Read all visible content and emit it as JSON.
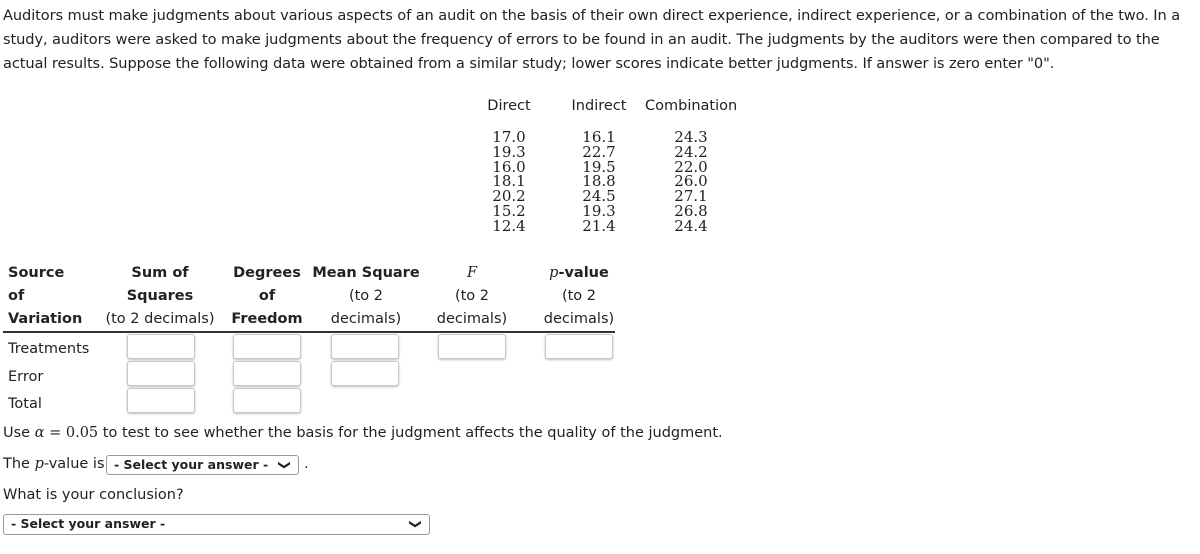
{
  "intro": "Auditors must make judgments about various aspects of an audit on the basis of their own direct experience, indirect experience, or a combination of the two. In a study, auditors were asked to make judgments about the frequency of errors to be found in an audit. The judgments by the auditors were then compared to the actual results. Suppose the following data were obtained from a similar study; lower scores indicate better judgments. If answer is zero enter \"0\".",
  "data_table": {
    "columns": [
      {
        "header": "Direct",
        "values": [
          "17.0",
          "19.3",
          "16.0",
          "18.1",
          "20.2",
          "15.2",
          "12.4"
        ]
      },
      {
        "header": "Indirect",
        "values": [
          "16.1",
          "22.7",
          "19.5",
          "18.8",
          "24.5",
          "19.3",
          "21.4"
        ]
      },
      {
        "header": "Combination",
        "values": [
          "24.3",
          "24.2",
          "22.0",
          "26.0",
          "27.1",
          "26.8",
          "24.4"
        ]
      }
    ]
  },
  "anova": {
    "headers": {
      "source": [
        "Source",
        "of",
        "Variation"
      ],
      "ss": [
        "Sum of",
        "Squares",
        "(to 2 decimals)"
      ],
      "df": [
        "Degrees",
        "of",
        "Freedom"
      ],
      "ms": [
        "Mean Square",
        "(to 2",
        "decimals)"
      ],
      "f": [
        "F",
        "(to 2",
        "decimals)"
      ],
      "p": [
        "p",
        "-value",
        "(to 2",
        "decimals)"
      ]
    },
    "rows": [
      "Treatments",
      "Error",
      "Total"
    ],
    "inputs": {
      "treatments_ss": "",
      "treatments_df": "",
      "treatments_ms": "",
      "treatments_f": "",
      "treatments_p": "",
      "error_ss": "",
      "error_df": "",
      "error_ms": "",
      "total_ss": "",
      "total_df": ""
    }
  },
  "alpha_line": {
    "prefix": "Use ",
    "alpha": "α",
    "eq": " = ",
    "value": "0.05",
    "suffix": " to test to see whether the basis for the judgment affects the quality of the judgment."
  },
  "pvalue_line": {
    "prefix": "The ",
    "p": "p",
    "mid": "-value is",
    "select": "- Select your answer -",
    "suffix": "."
  },
  "conclusion": {
    "question": "What is your conclusion?",
    "select": "- Select your answer -"
  },
  "icons": {
    "chevron": "❯"
  }
}
